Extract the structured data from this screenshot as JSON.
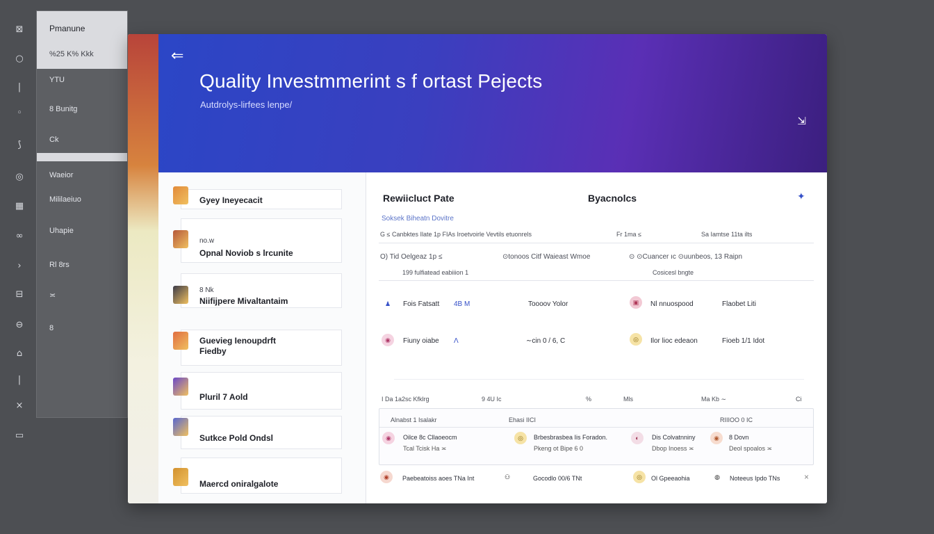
{
  "rail": {
    "icons": [
      "bookmark-icon",
      "search-icon",
      "pipe-icon",
      "circle-icon",
      "pen-icon",
      "eye-icon",
      "grid-icon",
      "glasses-icon",
      "chevron-right-icon",
      "chart-icon",
      "clock-icon",
      "clip-icon",
      "line-icon",
      "close-icon",
      "card-icon"
    ],
    "glyphs": [
      "⊠",
      "○",
      "|",
      "◦",
      "⟆",
      "◎",
      "▦",
      "∞",
      "›",
      "⊟",
      "⊖",
      "⌂",
      "|",
      "×",
      "▭"
    ]
  },
  "menu": {
    "head_title": "Pmanune",
    "head_sub": "%25 K% Kkk",
    "items": [
      "YTU",
      "8 Bunitg",
      "Ck",
      "Waeior",
      "Mililaeiuo",
      "Uhapie",
      "Rl 8rs",
      "≍",
      "8"
    ]
  },
  "hero": {
    "back_glyph": "⇐",
    "title": "Quality Investmmerint s f ortast Pejects",
    "subtitle": "Autdrolys-lirfees lenpe/",
    "action": "⇲"
  },
  "projects": [
    {
      "title": "Gyey Ineyecacit",
      "sub": "",
      "color": "#e28a3a"
    },
    {
      "title": "Opnal Noviob s lrcunite",
      "sub": "no.w",
      "color": "#b5583a"
    },
    {
      "title": "Niifijpere Mivaltantaim",
      "sub": "8 Nk",
      "color": "#3a3a48"
    },
    {
      "title": "Guevieg Ienoupdrft",
      "sub": "Fiedby",
      "color": "#e06d40"
    },
    {
      "title": "Pluril 7 Aold",
      "sub": "",
      "color": "#6a48c8"
    },
    {
      "title": "Sutkce Pold Ondsl",
      "sub": "",
      "color": "#5867d0"
    },
    {
      "title": "Maercd oniralgalote",
      "sub": "",
      "color": "#d2912e"
    }
  ],
  "panel": {
    "title_left": "Rewiicluct Pate",
    "title_right": "Byacnolcs",
    "star": "✦",
    "link": "Soksek  Biheatn Dovitre",
    "header_row": [
      "G  ≤  Canbktes Ilate  1p  FIAs  Iroetvoirle  Vevtils  etuonrels",
      "Fr  1ma  ≤",
      "Sa  Iamtse  11ta ilts"
    ],
    "sub_row": [
      "O)  Tid  Oelgeaz   1p  ≤",
      "⊙tonoos Citf  Waieast Wmoe",
      "⊙ ⊙Cuancer ıc ⊙uunbeos, 13 Raipn"
    ],
    "sub_row2": [
      "199  fulfiatead eabiiion  1",
      "Cosicesl bngte"
    ],
    "rows": [
      {
        "a": "Fois  Fatsatt",
        "b": "4B  M",
        "c": "Toooov Yolor",
        "d": "Nl  nnuospood",
        "e": "Flaobet  Liti"
      },
      {
        "a": "Fiuny oiabe",
        "b": "Λ",
        "c": "∼cin  0 / 6,  C",
        "d": "Ilor lioc edeaon",
        "e": "Fioeb  1/1 Idot"
      }
    ],
    "legend_row": [
      "I  Da  1a2sc  Kfklrg",
      "9  4U  Ic",
      "%",
      "Mls",
      "Ma  Kb  ∼",
      "Ci"
    ],
    "box_header": [
      "Alnabst 1  Isalakr",
      "Ehasi  IICI",
      "RIIIOO  0  IC"
    ],
    "box_cells": [
      {
        "l1": "Oilce 8c Cllaoeocm",
        "l2": "Tcal Tcisk Ha  ≍"
      },
      {
        "l1": "Brbesbrasbea Iis Foradon.",
        "l2": "Pkeng ot Bipe 6 0"
      },
      {
        "l1": "Dis Colvatnniny",
        "l2": "Dbop Inoess ≍"
      },
      {
        "l1": "8  Dovn",
        "l2": "Deol spoalos ≍"
      }
    ],
    "bottom_row": [
      "Paebeatoiss aoes  TNa  Int",
      "Gocodlo 00/6  TNt",
      "Ol Gpeeaohia",
      "Noteeus Ipdo  TNs"
    ],
    "bottom_close": "×"
  },
  "colors": {
    "accent": "#3550c8",
    "hero_start": "#2b46c6",
    "hero_end": "#3b1f7f"
  }
}
